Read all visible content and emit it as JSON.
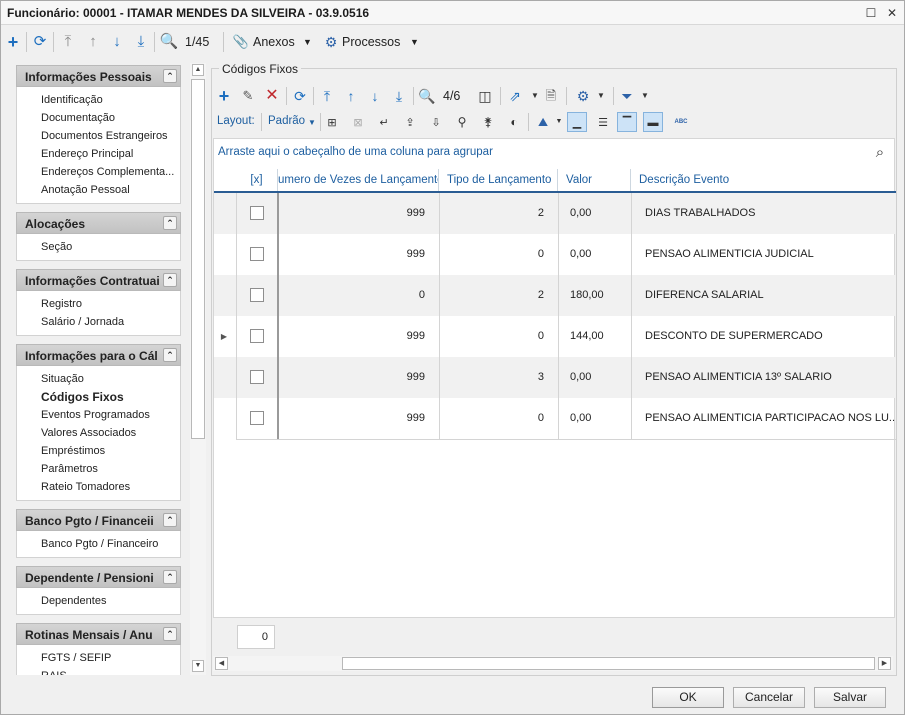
{
  "window": {
    "title": "Funcionário: 00001 - ITAMAR MENDES DA SILVEIRA - 03.9.0516"
  },
  "main_toolbar": {
    "record_position": "1/45",
    "attachments_label": "Anexos",
    "processes_label": "Processos"
  },
  "sidebar": {
    "groups": [
      {
        "title": "Informações Pessoais",
        "items": [
          "Identificação",
          "Documentação",
          "Documentos Estrangeiros",
          "Endereço Principal",
          "Endereços Complementa...",
          "Anotação Pessoal"
        ]
      },
      {
        "title": "Alocações",
        "items": [
          "Seção"
        ]
      },
      {
        "title": "Informações Contratuai",
        "items": [
          "Registro",
          "Salário / Jornada"
        ]
      },
      {
        "title": "Informações para o Cál",
        "items": [
          "Situação",
          "Códigos Fixos",
          "Eventos Programados",
          "Valores Associados",
          "Empréstimos",
          "Parâmetros",
          "Rateio Tomadores"
        ]
      },
      {
        "title": "Banco Pgto / Financeii",
        "items": [
          "Banco Pgto / Financeiro"
        ]
      },
      {
        "title": "Dependente / Pensioni",
        "items": [
          "Dependentes"
        ]
      },
      {
        "title": "Rotinas Mensais / Anu",
        "items": [
          "FGTS / SEFIP",
          "RAIS"
        ]
      }
    ],
    "active_item": "Códigos Fixos"
  },
  "content": {
    "section_title": "Códigos Fixos",
    "grid_toolbar": {
      "record_position": "4/6"
    },
    "layout_bar": {
      "layout_label": "Layout:",
      "layout_value": "Padrão"
    },
    "group_hint": "Arraste aqui o cabeçalho de uma coluna para agrupar",
    "columns": {
      "select": "[x]",
      "count": "umero de Vezes de Lançamento",
      "type": "Tipo de Lançamento",
      "value": "Valor",
      "description": "Descrição Evento"
    },
    "rows": [
      {
        "count": "999",
        "type": "2",
        "value": "0,00",
        "description": "DIAS TRABALHADOS"
      },
      {
        "count": "999",
        "type": "0",
        "value": "0,00",
        "description": "PENSAO ALIMENTICIA JUDICIAL"
      },
      {
        "count": "0",
        "type": "2",
        "value": "180,00",
        "description": "DIFERENCA SALARIAL"
      },
      {
        "count": "999",
        "type": "0",
        "value": "144,00",
        "description": "DESCONTO DE SUPERMERCADO"
      },
      {
        "count": "999",
        "type": "3",
        "value": "0,00",
        "description": "PENSAO ALIMENTICIA 13º SALARIO"
      },
      {
        "count": "999",
        "type": "0",
        "value": "0,00",
        "description": "PENSAO ALIMENTICIA PARTICIPACAO NOS LU..."
      }
    ],
    "footer_count": "0"
  },
  "buttons": {
    "ok": "OK",
    "cancel": "Cancelar",
    "save": "Salvar"
  },
  "icons": {
    "accent_color": "#1e6fbf",
    "delete_color": "#c0282d"
  }
}
